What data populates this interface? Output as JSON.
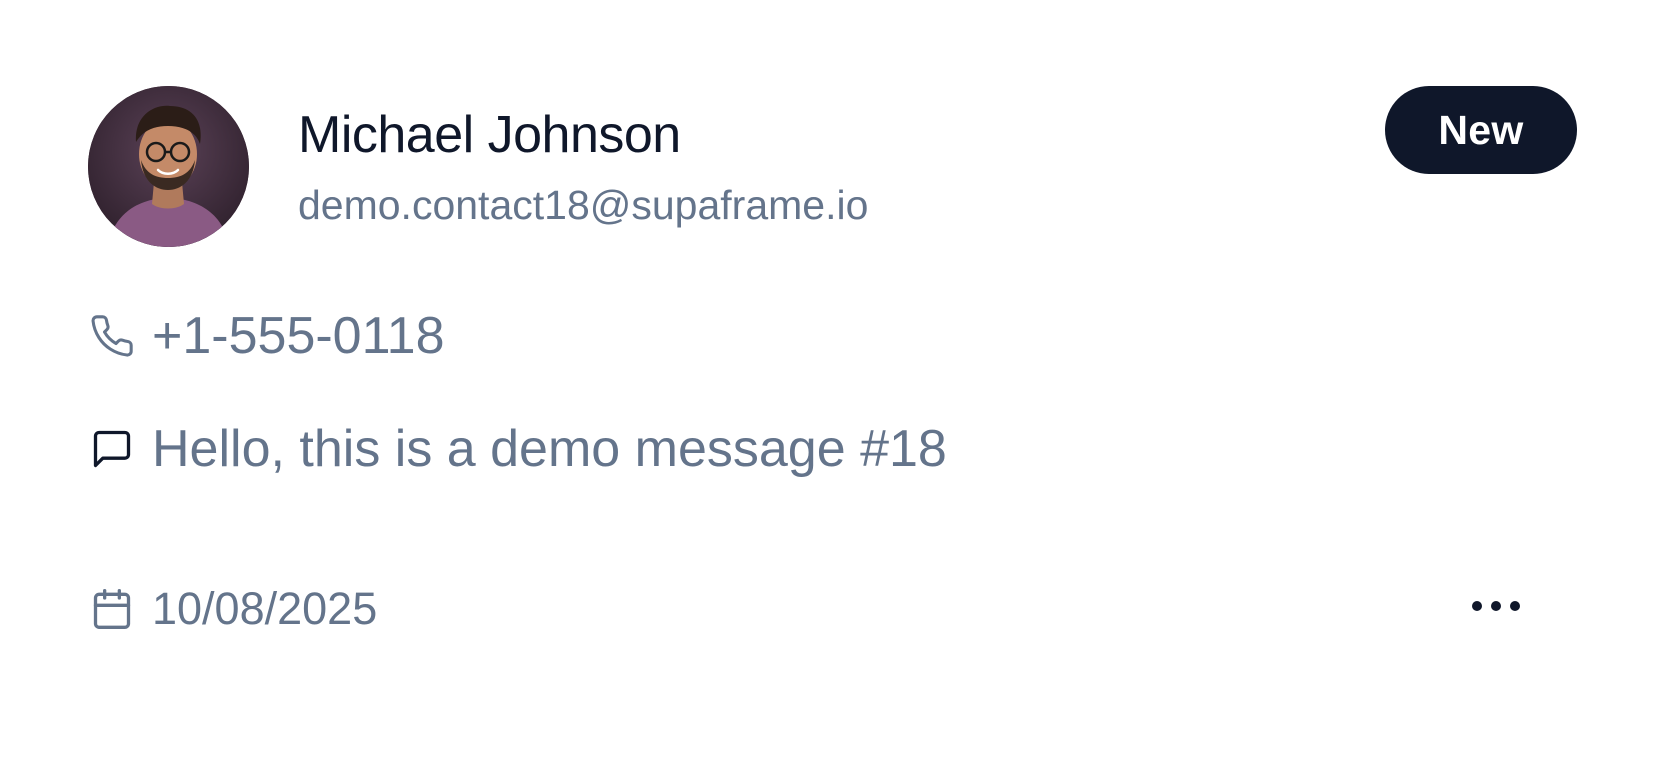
{
  "contact": {
    "name": "Michael Johnson",
    "email": "demo.contact18@supaframe.io",
    "badge": "New",
    "phone": "+1-555-0118",
    "message": "Hello, this is a demo message #18",
    "date": "10/08/2025"
  },
  "icons": {
    "phone": "phone-icon",
    "message": "message-square-icon",
    "date": "calendar-icon",
    "more": "more-horizontal-icon"
  },
  "colors": {
    "primary_text": "#0f172a",
    "muted_text": "#64748b",
    "badge_bg": "#0f172a",
    "badge_text": "#ffffff",
    "background": "#ffffff"
  }
}
